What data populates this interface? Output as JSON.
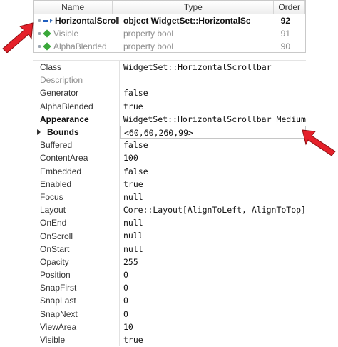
{
  "header": {
    "name": "Name",
    "type": "Type",
    "order": "Order"
  },
  "rows": [
    {
      "name": "HorizontalScrollbar",
      "type": "object WidgetSet::HorizontalScrollbar",
      "order": "92",
      "icon": "minus-icon",
      "selected": true
    },
    {
      "name": "Visible",
      "type": "property bool",
      "order": "91",
      "icon": "diamond-icon",
      "selected": false
    },
    {
      "name": "AlphaBlended",
      "type": "property bool",
      "order": "90",
      "icon": "diamond-icon",
      "selected": false
    }
  ],
  "properties": [
    {
      "name": "Class",
      "value": "WidgetSet::HorizontalScrollbar",
      "style": "normal"
    },
    {
      "name": "Description",
      "value": "",
      "style": "gray"
    },
    {
      "name": "Generator",
      "value": "false",
      "style": "normal"
    },
    {
      "name": "AlphaBlended",
      "value": "true",
      "style": "normal"
    },
    {
      "name": "Appearance",
      "value": "WidgetSet::HorizontalScrollbar_Medium",
      "style": "bold"
    },
    {
      "name": "Bounds",
      "value": "<60,60,260,99>",
      "style": "bold-expand"
    },
    {
      "name": "Buffered",
      "value": "false",
      "style": "normal"
    },
    {
      "name": "ContentArea",
      "value": "100",
      "style": "normal"
    },
    {
      "name": "Embedded",
      "value": "false",
      "style": "normal"
    },
    {
      "name": "Enabled",
      "value": "true",
      "style": "normal"
    },
    {
      "name": "Focus",
      "value": "null",
      "style": "normal"
    },
    {
      "name": "Layout",
      "value": "Core::Layout[AlignToLeft, AlignToTop]",
      "style": "normal"
    },
    {
      "name": "OnEnd",
      "value": "null",
      "style": "normal"
    },
    {
      "name": "OnScroll",
      "value": "null",
      "style": "normal"
    },
    {
      "name": "OnStart",
      "value": "null",
      "style": "normal"
    },
    {
      "name": "Opacity",
      "value": "255",
      "style": "normal"
    },
    {
      "name": "Position",
      "value": "0",
      "style": "normal"
    },
    {
      "name": "SnapFirst",
      "value": "0",
      "style": "normal"
    },
    {
      "name": "SnapLast",
      "value": "0",
      "style": "normal"
    },
    {
      "name": "SnapNext",
      "value": "0",
      "style": "normal"
    },
    {
      "name": "ViewArea",
      "value": "10",
      "style": "normal"
    },
    {
      "name": "Visible",
      "value": "true",
      "style": "normal"
    }
  ],
  "colors": {
    "annotation": "#e5202a",
    "icon_minus": "#1f5fbf",
    "icon_diamond": "#3aa83a"
  }
}
